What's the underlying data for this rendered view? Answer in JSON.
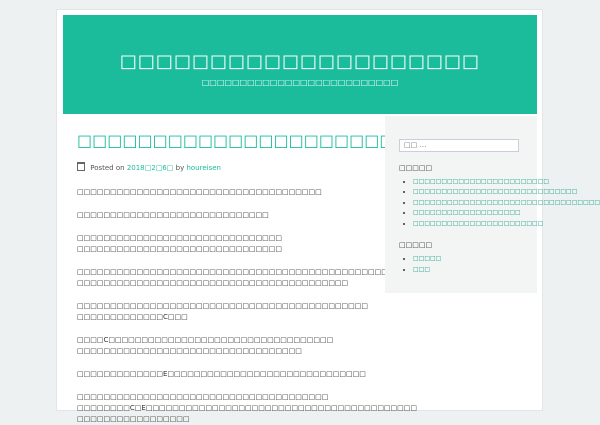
{
  "site": {
    "title": "□□□□□□□□□□□□□□□□□□□□",
    "description": "□□□□□□□□□□□□□□□□□□□□□□□□□□"
  },
  "post": {
    "title": "□□□□□□□□□□□□□□□□□□□□□□",
    "posted_on_label": "Posted on",
    "date": "2018□2□6□",
    "by_label": "by",
    "author": "houreisen",
    "paragraphs": [
      [
        "□□□□□□□□□□□□□□□□□□□□□□□□□□□□□□□□□□□□□"
      ],
      [
        "□□□□□□□□□□□□□□□□□□□□□□□□□□□□□"
      ],
      [
        "□□□□□□□□□□□□□□□□□□□□□□□□□□□□□□□",
        "□□□□□□□□□□□□□□□□□□□□□□□□□□□□□□□"
      ],
      [
        "□□□□□□□□□□□□□□□□□□□□□□□□□□□□□□□□□□□□□□□□□□□□□□□",
        "□□□□□□□□□□□□□□□□□□□□□□□□□□□□□□□□□□□□□□□□□"
      ],
      [
        "□□□□□□□□□□□□□□□□□□□□□□□□□□□□□□□□□□□□□□□□□□□□",
        "□□□□□□□□□□□□□C□□□"
      ],
      [
        "□□□□C□□□□□□□□□□□□□□□□□□□□□□□□□□□□□□□□□□",
        "□□□□□□□□□□□□□□□□□□□□□□□□□□□□□□□□□□"
      ],
      [
        "□□□□□□□□□□□□□E□□□□□□□□□□□□□□□□□□□□□□□□□□□□□□"
      ],
      [
        "□□□□□□□□□□□□□□□□□□□□□□□□□□□□□□□□□□□□□□",
        "□□□□□□□□C□E□□□□□□□□□□□□□□□□□□□□□□□□□□□□□□□□□□□□□□□□□",
        "□□□□□□□□□□□□□□□□□"
      ]
    ]
  },
  "sidebar": {
    "search_placeholder": "□□ …",
    "widget1_title": "□□□□□",
    "widget1_items": [
      "□□□□□□□□□□□□□□□□□□□□□□□□",
      "□□□□□□□□□□□□□□□□□□□□□□□□□□□□□",
      "□□□□□□□□□□□□□□□□□□□□□□□□□□□□□□□□□",
      "□□□□□□□□□□□□□□□□□□□",
      "□□□□□□□□□□□□□□□□□□□□□□□"
    ],
    "widget2_title": "□□□□□",
    "widget2_items": [
      "□□□□□",
      "□□□"
    ]
  }
}
